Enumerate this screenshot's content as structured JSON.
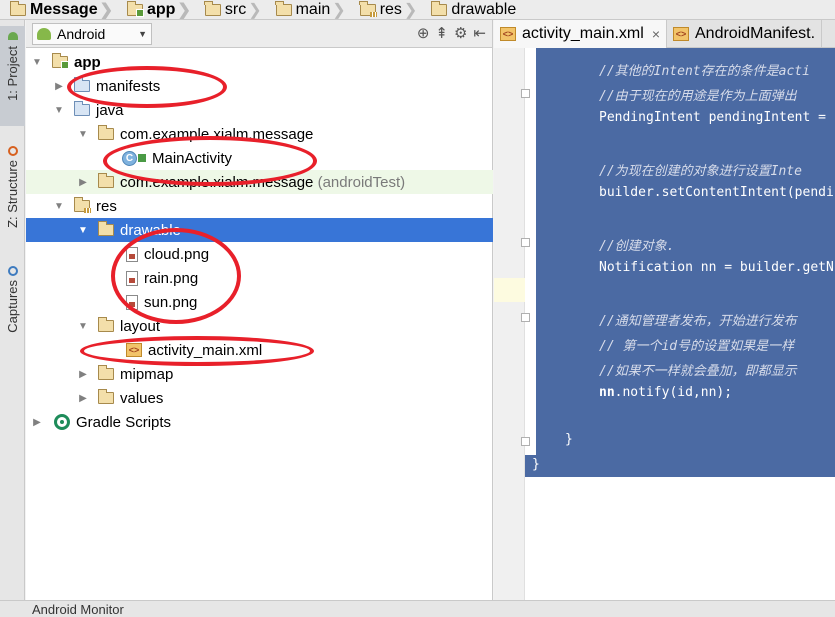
{
  "breadcrumb": [
    {
      "label": "Message",
      "icon": "module-folder-icon",
      "bold": true
    },
    {
      "label": "app",
      "icon": "app-folder-icon",
      "bold": true
    },
    {
      "label": "src",
      "icon": "folder-icon"
    },
    {
      "label": "main",
      "icon": "folder-icon"
    },
    {
      "label": "res",
      "icon": "res-folder-icon"
    },
    {
      "label": "drawable",
      "icon": "folder-icon"
    }
  ],
  "side_tabs": {
    "project": "1: Project",
    "structure": "Z: Structure",
    "captures": "Captures"
  },
  "panel": {
    "view_select": "Android"
  },
  "tree": {
    "app": "app",
    "manifests": "manifests",
    "java": "java",
    "pkg_main": "com.example.xialm.message",
    "main_activity": "MainActivity",
    "pkg_test": "com.example.xialm.message",
    "pkg_test_suffix": "(androidTest)",
    "res": "res",
    "drawable": "drawable",
    "cloud": "cloud.png",
    "rain": "rain.png",
    "sun": "sun.png",
    "layout": "layout",
    "activity_main": "activity_main.xml",
    "mipmap": "mipmap",
    "values": "values",
    "gradle": "Gradle Scripts"
  },
  "editor_tabs": {
    "tab1": "activity_main.xml",
    "tab2": "AndroidManifest."
  },
  "code": {
    "l1": "//其他的Intent存在的条件是acti",
    "l2": "//由于现在的用途是作为上面弹出",
    "l3": "PendingIntent pendingIntent =",
    "l4": "//为现在创建的对象进行设置Inte",
    "l5": "builder.setContentIntent(pendi",
    "l6": "//创建对象.",
    "l7": "Notification nn = builder.getN",
    "l8": "//通知管理者发布，开始进行发布",
    "l9": "// 第一个id号的设置如果是一样",
    "l10": "//如果不一样就会叠加，即都显示",
    "l11_kw": "nn",
    "l11_rest": ".notify(id,nn);",
    "close1": "}",
    "close2": "}"
  },
  "bottom": {
    "label": "Android Monitor"
  },
  "colors": {
    "selection": "#3875d7",
    "code_selection": "#4b6aa3",
    "annotation": "#e8202a"
  }
}
